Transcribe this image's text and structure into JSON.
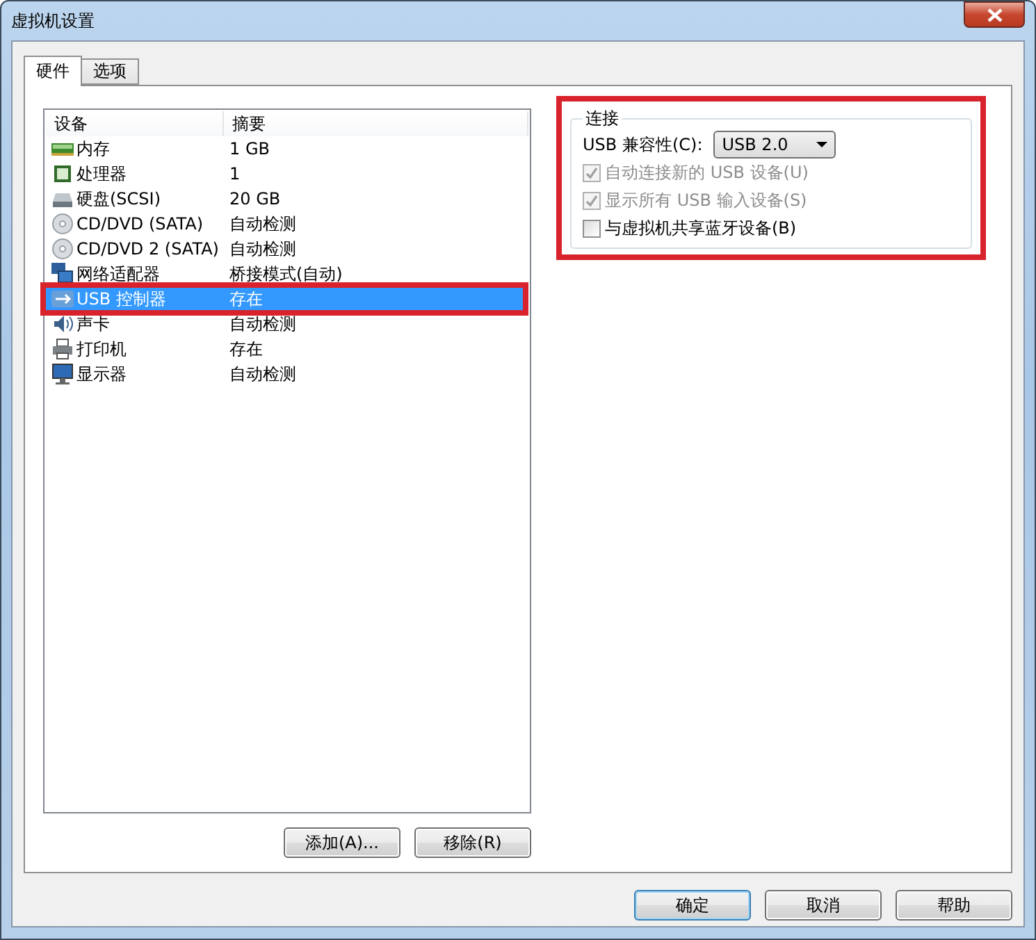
{
  "window": {
    "title": "虚拟机设置"
  },
  "tabs": [
    {
      "label": "硬件",
      "selected": true
    },
    {
      "label": "选项",
      "selected": false
    }
  ],
  "devices": {
    "columns": [
      "设备",
      "摘要"
    ],
    "rows": [
      {
        "name": "内存",
        "summary": "1 GB",
        "selected": false,
        "highlighted": false
      },
      {
        "name": "处理器",
        "summary": "1",
        "selected": false,
        "highlighted": false
      },
      {
        "name": "硬盘(SCSI)",
        "summary": "20 GB",
        "selected": false,
        "highlighted": false
      },
      {
        "name": "CD/DVD (SATA)",
        "summary": "自动检测",
        "selected": false,
        "highlighted": false
      },
      {
        "name": "CD/DVD 2 (SATA)",
        "summary": "自动检测",
        "selected": false,
        "highlighted": false
      },
      {
        "name": "网络适配器",
        "summary": "桥接模式(自动)",
        "selected": false,
        "highlighted": false
      },
      {
        "name": "USB 控制器",
        "summary": "存在",
        "selected": true,
        "highlighted": true
      },
      {
        "name": "声卡",
        "summary": "自动检测",
        "selected": false,
        "highlighted": false
      },
      {
        "name": "打印机",
        "summary": "存在",
        "selected": false,
        "highlighted": false
      },
      {
        "name": "显示器",
        "summary": "自动检测",
        "selected": false,
        "highlighted": false
      }
    ]
  },
  "device_buttons": [
    "添加(A)...",
    "移除(R)"
  ],
  "connection": {
    "title": "连接",
    "highlighted": true,
    "compat_label": "USB 兼容性(C):",
    "compat_value": "USB 2.0",
    "options": [
      {
        "label": "自动连接新的 USB 设备(U)",
        "checked": true,
        "disabled": true
      },
      {
        "label": "显示所有 USB 输入设备(S)",
        "checked": true,
        "disabled": true
      },
      {
        "label": "与虚拟机共享蓝牙设备(B)",
        "checked": false,
        "disabled": false
      }
    ]
  },
  "buttons": [
    {
      "label": "确定",
      "default": true
    },
    {
      "label": "取消",
      "default": false
    },
    {
      "label": "帮助",
      "default": false
    }
  ]
}
